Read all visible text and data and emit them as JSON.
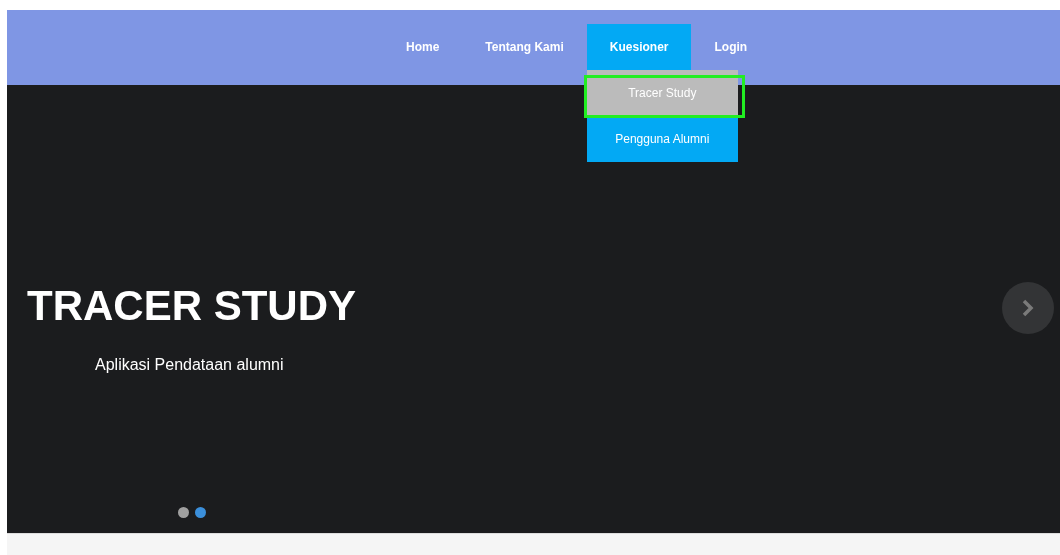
{
  "nav": {
    "items": [
      {
        "label": "Home",
        "selected": false
      },
      {
        "label": "Tentang Kami",
        "selected": false
      },
      {
        "label": "Kuesioner",
        "selected": true,
        "dropdown": [
          {
            "label": "Tracer Study",
            "highlighted": true
          },
          {
            "label": "Pengguna Alumni",
            "highlighted": false
          }
        ]
      },
      {
        "label": "Login",
        "selected": false
      }
    ]
  },
  "hero": {
    "title": "TRACER STUDY",
    "subtitle": "Aplikasi Pendataan alumni",
    "dots": [
      {
        "selected": false
      },
      {
        "selected": true
      }
    ]
  }
}
